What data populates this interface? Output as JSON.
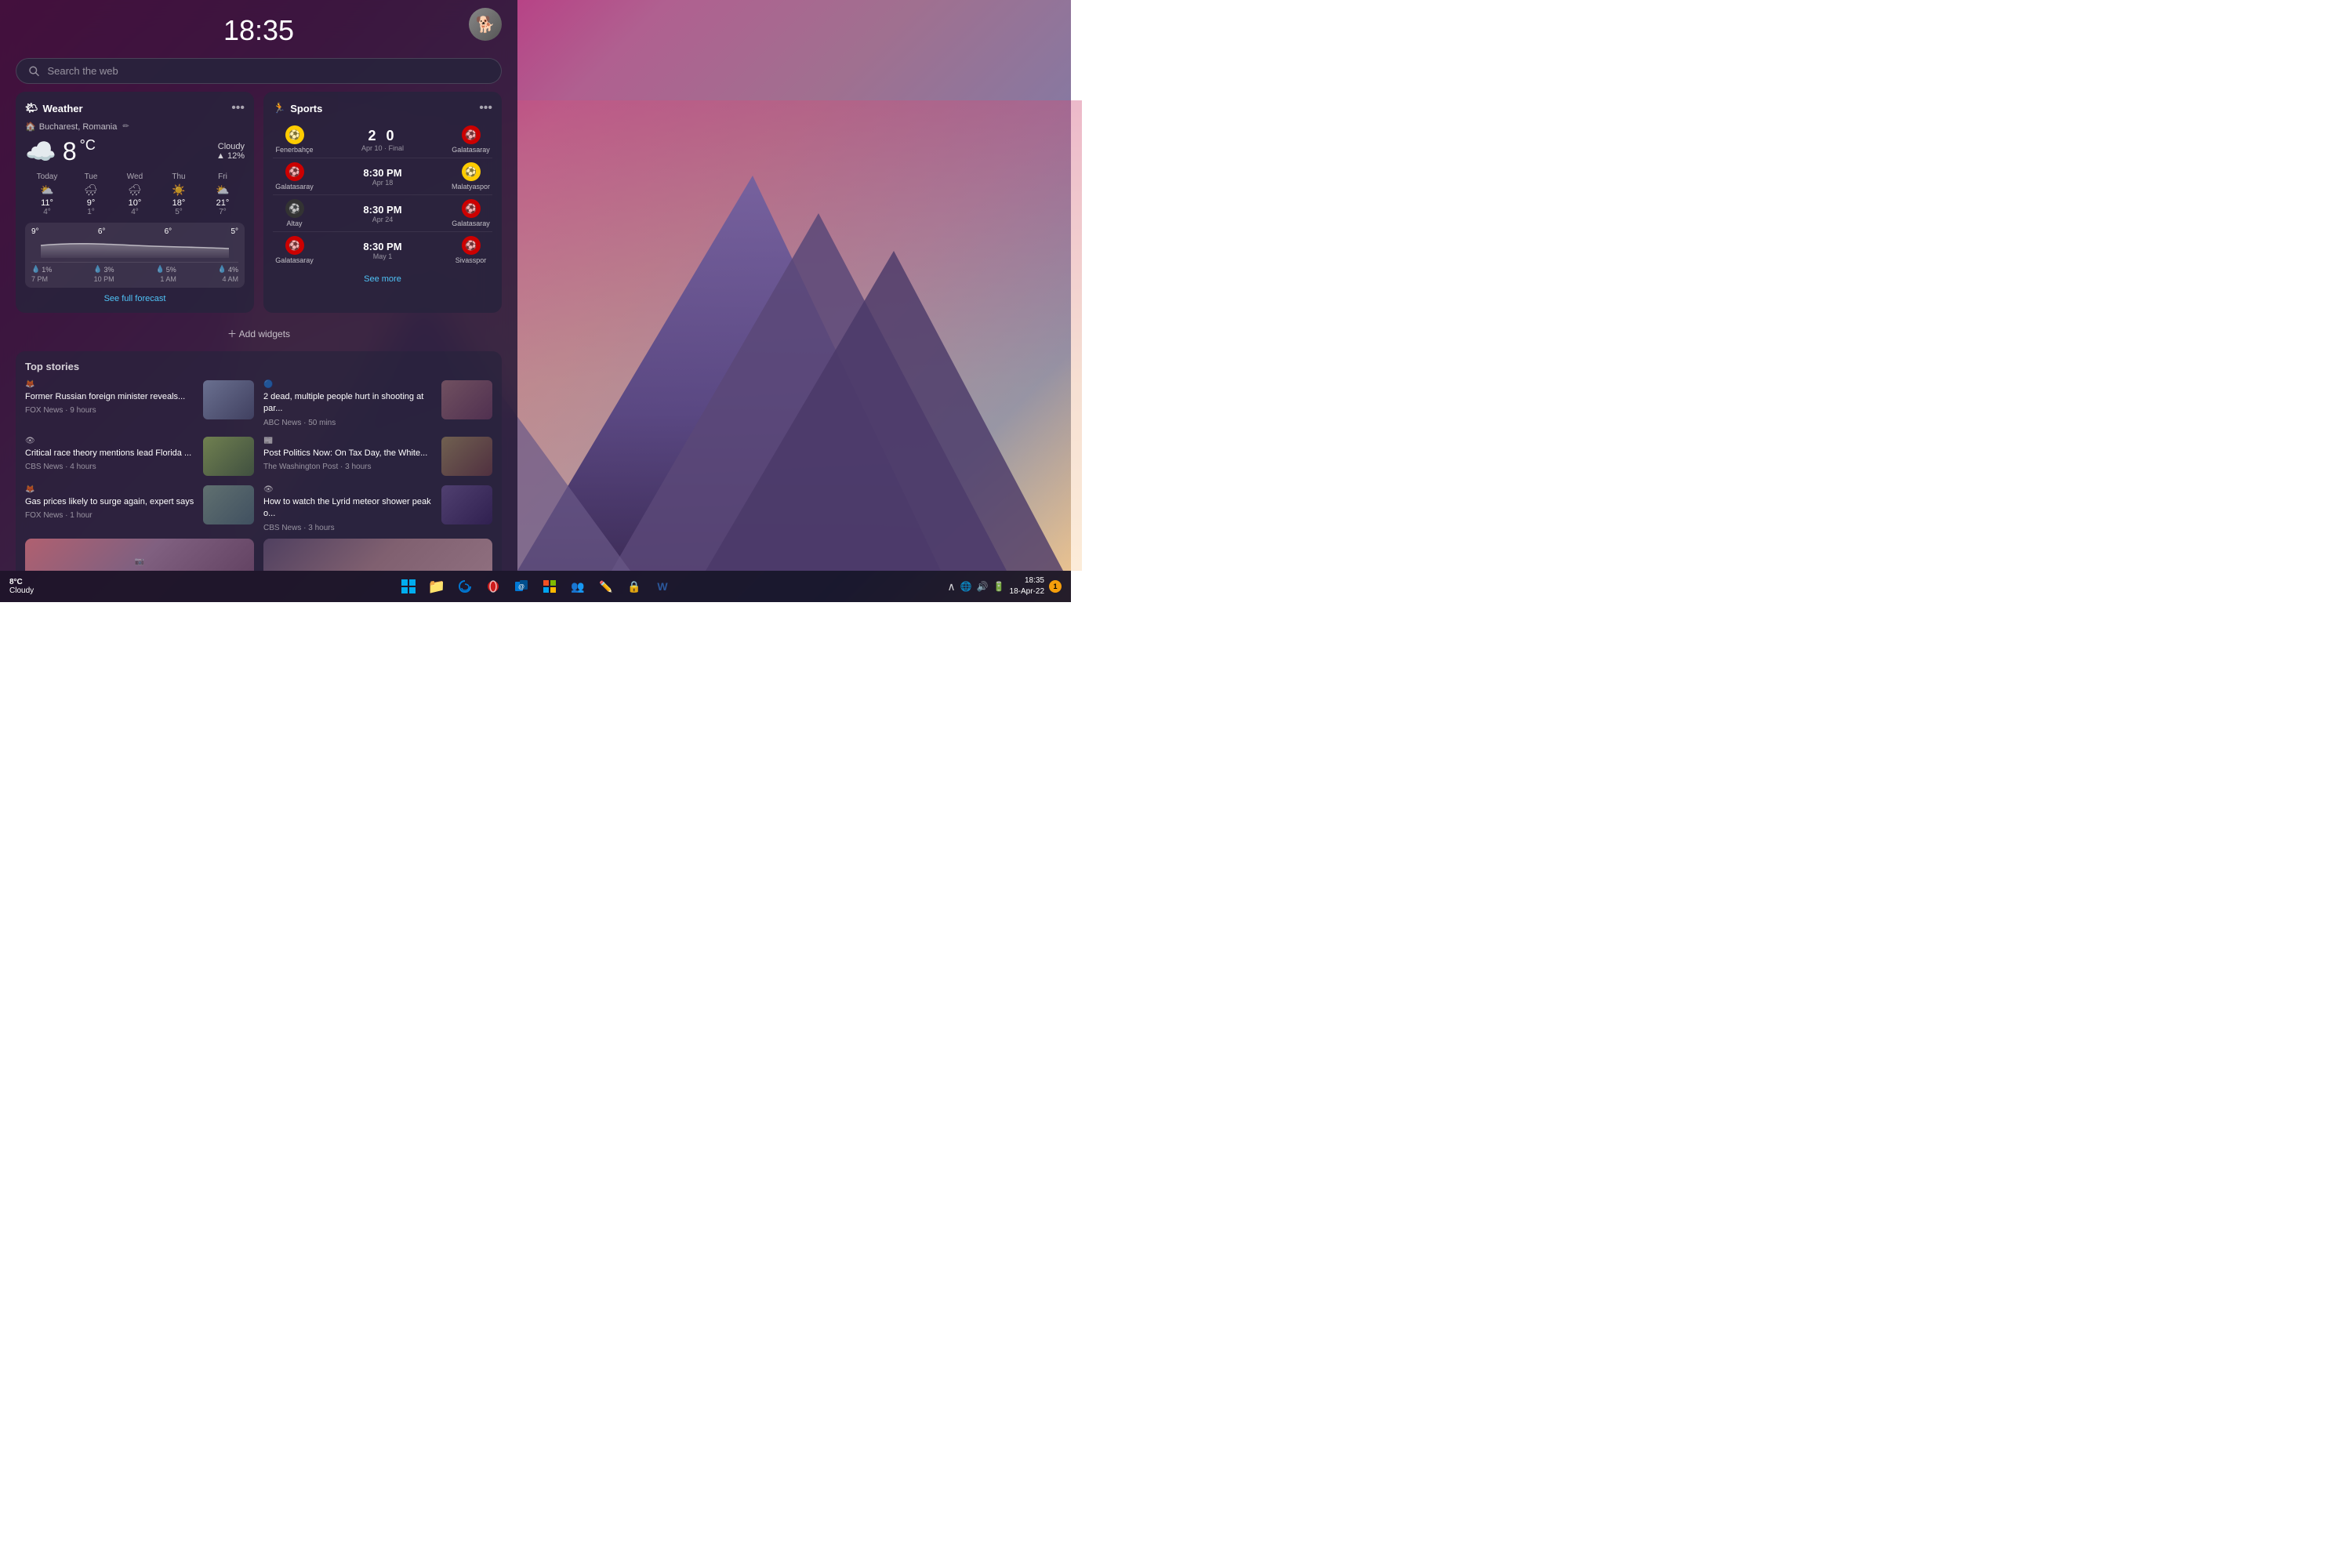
{
  "clock": "18:35",
  "search": {
    "placeholder": "Search the web"
  },
  "weather": {
    "title": "Weather",
    "location": "Bucharest, Romania",
    "temp": "8",
    "unit": "°C",
    "condition": "Cloudy",
    "precip_chance": "▲ 12%",
    "forecast": [
      {
        "day": "Today",
        "icon": "⛅",
        "high": "11°",
        "low": "4°"
      },
      {
        "day": "Tue",
        "icon": "🌧",
        "high": "9°",
        "low": "1°"
      },
      {
        "day": "Wed",
        "icon": "🌧",
        "high": "10°",
        "low": "4°"
      },
      {
        "day": "Thu",
        "icon": "☀️",
        "high": "18°",
        "low": "5°"
      },
      {
        "day": "Fri",
        "icon": "⛅",
        "high": "21°",
        "low": "7°"
      }
    ],
    "hourly_temps": [
      "9°",
      "6°",
      "6°",
      "5°"
    ],
    "hourly_precip": [
      "1%",
      "3%",
      "5%",
      "4%"
    ],
    "hourly_times": [
      "7 PM",
      "10 PM",
      "1 AM",
      "4 AM"
    ],
    "see_forecast": "See full forecast"
  },
  "sports": {
    "title": "Sports",
    "matches": [
      {
        "home_team": "Fenerbahçe",
        "away_team": "Galatasaray",
        "score": "2  0",
        "date": "Apr 10 · Final",
        "home_logo": "🟡",
        "away_logo": "🔴"
      },
      {
        "home_team": "Galatasaray",
        "away_team": "Malatyaspor",
        "time": "8:30 PM",
        "date": "Apr 18",
        "home_logo": "🔴",
        "away_logo": "🟡"
      },
      {
        "home_team": "Altay",
        "away_team": "Galatasaray",
        "time": "8:30 PM",
        "date": "Apr 24",
        "home_logo": "⚫",
        "away_logo": "🔴"
      },
      {
        "home_team": "Galatasaray",
        "away_team": "Sivasspor",
        "time": "8:30 PM",
        "date": "May 1",
        "home_logo": "🔴",
        "away_logo": "🔴"
      }
    ],
    "see_more": "See more"
  },
  "add_widgets_label": "Add widgets",
  "news": {
    "section_title": "Top stories",
    "items": [
      {
        "headline": "Former Russian foreign minister reveals...",
        "source": "FOX News",
        "time": "9 hours",
        "source_color": "#c0392b"
      },
      {
        "headline": "2 dead, multiple people hurt in shooting at par...",
        "source": "ABC News",
        "time": "50 mins",
        "source_color": "#1a237e"
      },
      {
        "headline": "Critical race theory mentions lead Florida ...",
        "source": "CBS News",
        "time": "4 hours",
        "source_color": "#1565c0"
      },
      {
        "headline": "Post Politics Now: On Tax Day, the White...",
        "source": "The Washington Post",
        "time": "3 hours",
        "source_color": "#333"
      },
      {
        "headline": "Gas prices likely to surge again, expert says",
        "source": "FOX News",
        "time": "1 hour",
        "source_color": "#c0392b"
      },
      {
        "headline": "How to watch the Lyrid meteor shower peak o...",
        "source": "CBS News",
        "time": "3 hours",
        "source_color": "#1565c0"
      }
    ]
  },
  "taskbar": {
    "weather_temp": "8°C",
    "weather_condition": "Cloudy",
    "icons": [
      "⊞",
      "📁",
      "🌐",
      "🔴",
      "💼",
      "🔵",
      "🎮",
      "✏️",
      "🔒",
      "W"
    ],
    "time": "18:35",
    "date": "18-Apr-22",
    "notification_count": "1"
  }
}
